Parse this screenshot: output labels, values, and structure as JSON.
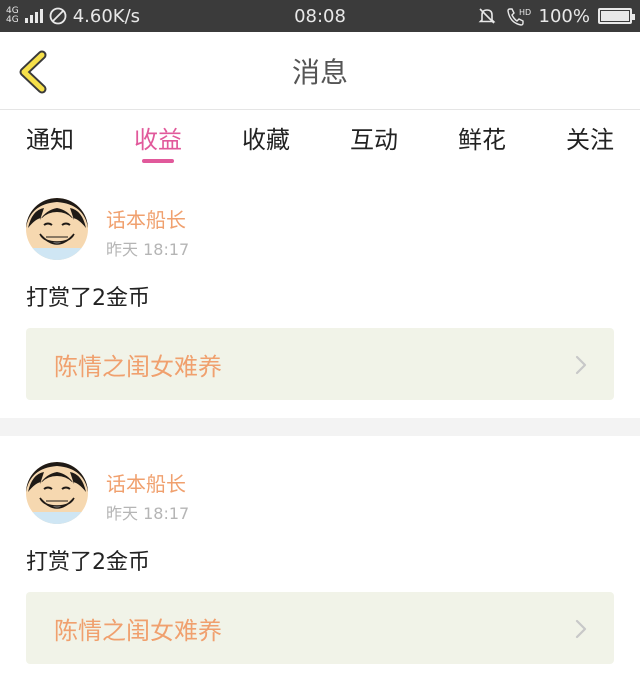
{
  "status_bar": {
    "network": "4G",
    "network2": "4G",
    "speed": "4.60K/s",
    "time": "08:08",
    "hd": "HD",
    "battery": "100%"
  },
  "header": {
    "title": "消息"
  },
  "tabs": [
    {
      "label": "通知",
      "active": false
    },
    {
      "label": "收益",
      "active": true
    },
    {
      "label": "收藏",
      "active": false
    },
    {
      "label": "互动",
      "active": false
    },
    {
      "label": "鲜花",
      "active": false
    },
    {
      "label": "关注",
      "active": false
    }
  ],
  "messages": [
    {
      "username": "话本船长",
      "time": "昨天 18:17",
      "text": "打赏了2金币",
      "book": "陈情之闺女难养"
    },
    {
      "username": "话本船长",
      "time": "昨天 18:17",
      "text": "打赏了2金币",
      "book": "陈情之闺女难养"
    }
  ],
  "colors": {
    "accent": "#e1599b",
    "orange": "#f0a06e",
    "card_bg": "#f1f3e8"
  }
}
